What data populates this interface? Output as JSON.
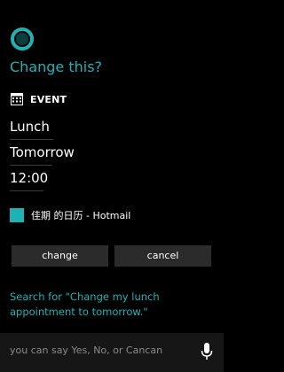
{
  "heading": "Change this?",
  "event_label": "EVENT",
  "fields": {
    "subject": "Lunch",
    "date": "Tomorrow",
    "time": "12:00"
  },
  "calendar": {
    "name": "佳期 的日历 - Hotmail",
    "color": "#1fb2b4"
  },
  "buttons": {
    "change": "change",
    "cancel": "cancel"
  },
  "search_text": "Search for \"Change my lunch appointment to tomorrow.\"",
  "hint_text": "you can say Y⁠e⁠s, No, or Cancan",
  "colors": {
    "accent": "#1fb2b4",
    "background": "#000000",
    "button": "#2b2b2b"
  },
  "icons": [
    "cortana-logo-icon",
    "calendar-icon",
    "microphone-icon"
  ]
}
